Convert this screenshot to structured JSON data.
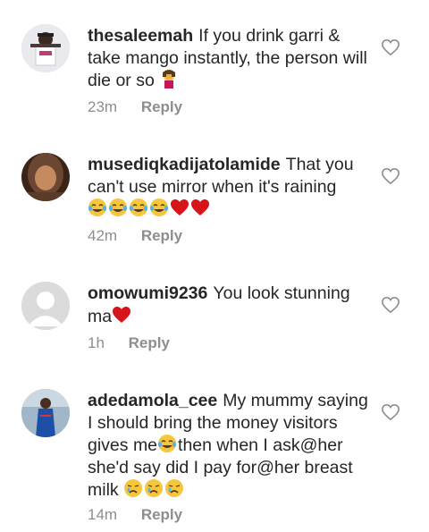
{
  "comments": [
    {
      "username": "thesaleemah",
      "text": "If you drink garri & take mango instantly, the person will die or so",
      "emoji_after": [
        "facepalm-emoji"
      ],
      "time": "23m",
      "reply_label": "Reply"
    },
    {
      "username": "musediqkadijatolamide",
      "text": "That you can't use mirror when it's raining",
      "emoji_after": [
        "tears-of-joy-emoji",
        "tears-of-joy-emoji",
        "tears-of-joy-emoji",
        "tears-of-joy-emoji",
        "red-heart-emoji",
        "red-heart-emoji"
      ],
      "time": "42m",
      "reply_label": "Reply"
    },
    {
      "username": "omowumi9236",
      "text": "You look stunning ma",
      "emoji_after": [
        "red-heart-emoji"
      ],
      "time": "1h",
      "reply_label": "Reply"
    },
    {
      "username": "adedamola_cee",
      "text_before": "My mummy saying I should bring the money visitors gives me",
      "text_after": "then when I ask@her she'd say did I pay for@her breast milk",
      "emoji_mid": [
        "tears-of-joy-emoji"
      ],
      "emoji_after": [
        "crying-face-emoji",
        "crying-face-emoji",
        "crying-face-emoji"
      ],
      "time": "14m",
      "reply_label": "Reply"
    }
  ],
  "colors": {
    "text": "#262626",
    "meta": "#8e8e8e",
    "heart_outline": "#8e8e8e"
  }
}
